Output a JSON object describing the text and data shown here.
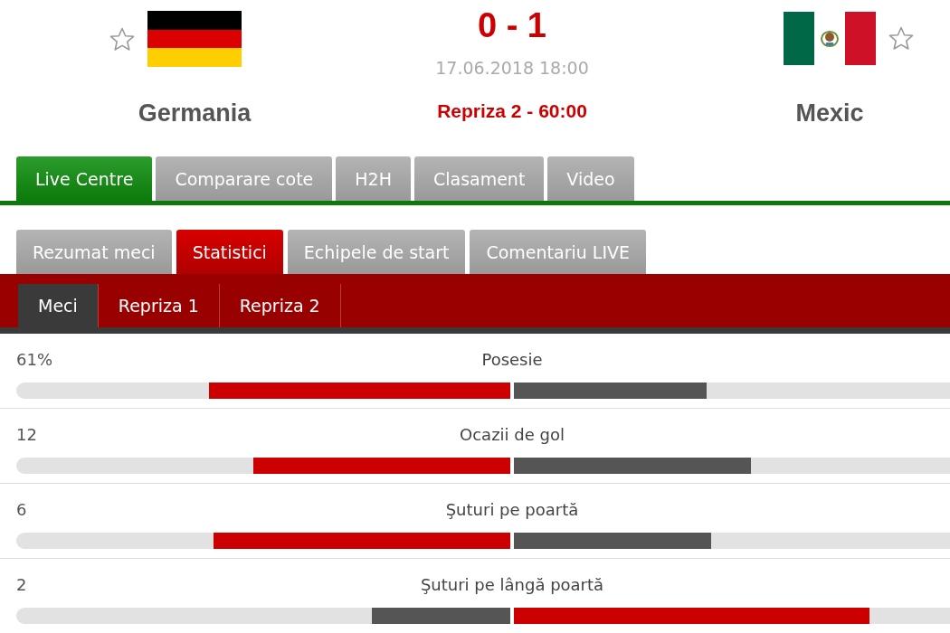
{
  "home_team": {
    "name": "Germania",
    "favorite": false
  },
  "score": "0 - 1",
  "kickoff": "17.06.2018 18:00",
  "match_status": "Repriza 2 - 60:00",
  "away_team": {
    "name": "Mexic",
    "favorite": false
  },
  "main_tabs": [
    {
      "label": "Live Centre",
      "selected": true
    },
    {
      "label": "Comparare cote",
      "selected": false
    },
    {
      "label": "H2H",
      "selected": false
    },
    {
      "label": "Clasament",
      "selected": false
    },
    {
      "label": "Video",
      "selected": false
    }
  ],
  "section_tabs": [
    {
      "label": "Rezumat meci",
      "selected": false
    },
    {
      "label": "Statistici",
      "selected": true
    },
    {
      "label": "Echipele de start",
      "selected": false
    },
    {
      "label": "Comentariu LIVE",
      "selected": false
    }
  ],
  "period_tabs": [
    {
      "label": "Meci",
      "selected": true
    },
    {
      "label": "Repriza 1",
      "selected": false
    },
    {
      "label": "Repriza 2",
      "selected": false
    }
  ],
  "stats": [
    {
      "title": "Posesie",
      "home_value": "61%",
      "home_bar": {
        "level": 0.61
      },
      "away_bar": {
        "level": 0.39
      }
    },
    {
      "title": "Ocazii de gol",
      "home_value": "12",
      "home_bar": {
        "level": 0.52
      },
      "away_bar": {
        "level": 0.48
      }
    },
    {
      "title": "Şuturi pe poartă",
      "home_value": "6",
      "home_bar": {
        "level": 0.6
      },
      "away_bar": {
        "level": 0.4
      }
    },
    {
      "title": "Şuturi pe lângă poartă",
      "home_value": "2",
      "home_bar": {
        "level": 0.28
      },
      "away_bar": {
        "level": 0.72
      }
    }
  ]
}
